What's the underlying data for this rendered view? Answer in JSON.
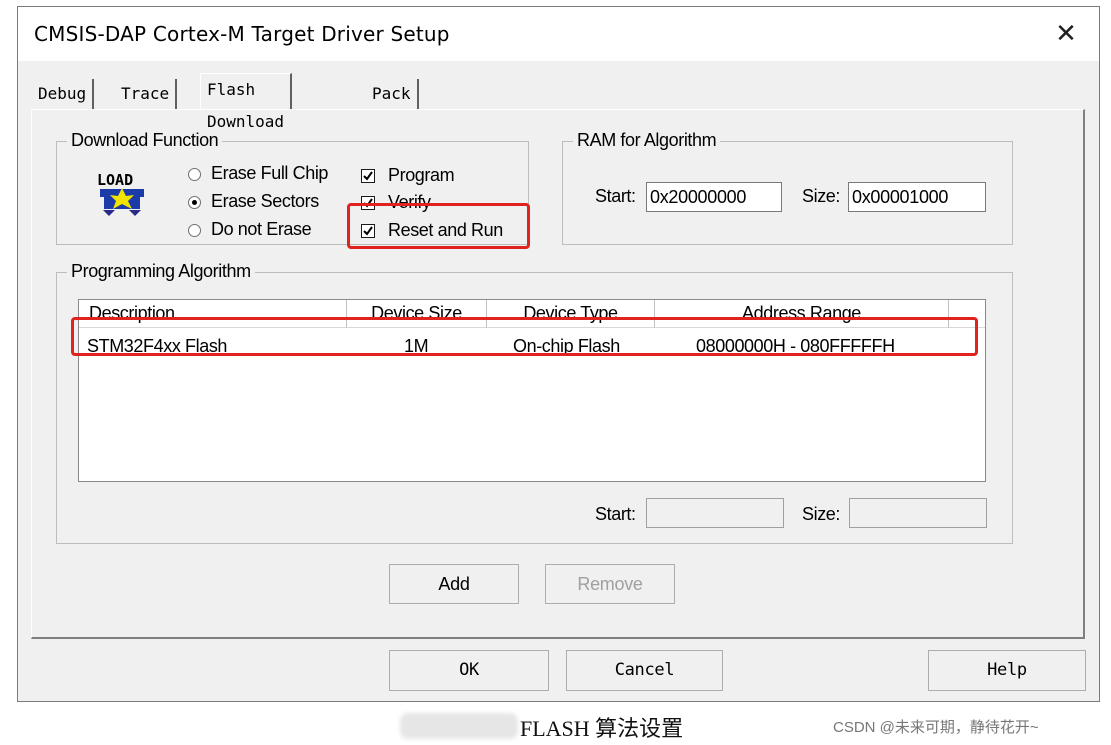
{
  "window": {
    "title": "CMSIS-DAP Cortex-M Target Driver Setup",
    "close_label": "✕"
  },
  "tabs": [
    {
      "label": "Debug"
    },
    {
      "label": "Trace"
    },
    {
      "label": "Flash Download"
    },
    {
      "label": "Pack"
    }
  ],
  "download_function": {
    "label": "Download Function",
    "load_icon_text": "LOAD",
    "erase_options": [
      {
        "label": "Erase Full Chip",
        "selected": false
      },
      {
        "label": "Erase Sectors",
        "selected": true
      },
      {
        "label": "Do not Erase",
        "selected": false
      }
    ],
    "checks": [
      {
        "label": "Program",
        "checked": true
      },
      {
        "label": "Verify",
        "checked": true
      },
      {
        "label": "Reset and Run",
        "checked": true
      }
    ]
  },
  "ram": {
    "label": "RAM for Algorithm",
    "start_label": "Start:",
    "start_value": "0x20000000",
    "size_label": "Size:",
    "size_value": "0x00001000"
  },
  "programming_algorithm": {
    "label": "Programming Algorithm",
    "columns": [
      "Description",
      "Device Size",
      "Device Type",
      "Address Range"
    ],
    "rows": [
      {
        "description": "STM32F4xx Flash",
        "size": "1M",
        "type": "On-chip Flash",
        "range": "08000000H - 080FFFFFH"
      }
    ],
    "start_label": "Start:",
    "start_value": "",
    "size_label": "Size:",
    "size_value": ""
  },
  "buttons": {
    "add": "Add",
    "remove": "Remove",
    "ok": "OK",
    "cancel": "Cancel",
    "help": "Help"
  },
  "caption": "FLASH 算法设置",
  "watermark": "CSDN @未来可期，静待花开~",
  "colors": {
    "highlight": "#e0231f",
    "dialog_bg": "#f0f0f0"
  }
}
